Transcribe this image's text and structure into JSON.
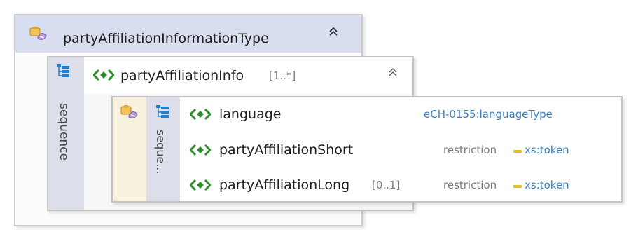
{
  "complex_type": {
    "name": "partyAffiliationInformationType",
    "collapse_glyph": "≈",
    "icon": "complex-type-icon"
  },
  "info_element": {
    "name": "partyAffiliationInfo",
    "multiplicity": "[1..*]",
    "collapse_glyph": "≈",
    "icon": "element-diamond-icon",
    "compositor_icon": "sequence-tree-icon",
    "compositor_label": "sequence"
  },
  "inner_sequence": {
    "compositor_label": "seque...",
    "type_icon": "complex-type-icon",
    "compositor_icon": "sequence-tree-icon"
  },
  "children": [
    {
      "name": "language",
      "multiplicity": "",
      "restriction": "",
      "type": "eCH-0155:languageType"
    },
    {
      "name": "partyAffiliationShort",
      "multiplicity": "",
      "restriction": "restriction",
      "type": "xs:token"
    },
    {
      "name": "partyAffiliationLong",
      "multiplicity": "[0..1]",
      "restriction": "restriction",
      "type": "xs:token"
    }
  ],
  "colors": {
    "element_icon_green": "#2e8b2e",
    "type_link_blue": "#3c7fc0",
    "restriction_yellow": "#e5bf2a",
    "header_lavender": "#d8ddef"
  }
}
